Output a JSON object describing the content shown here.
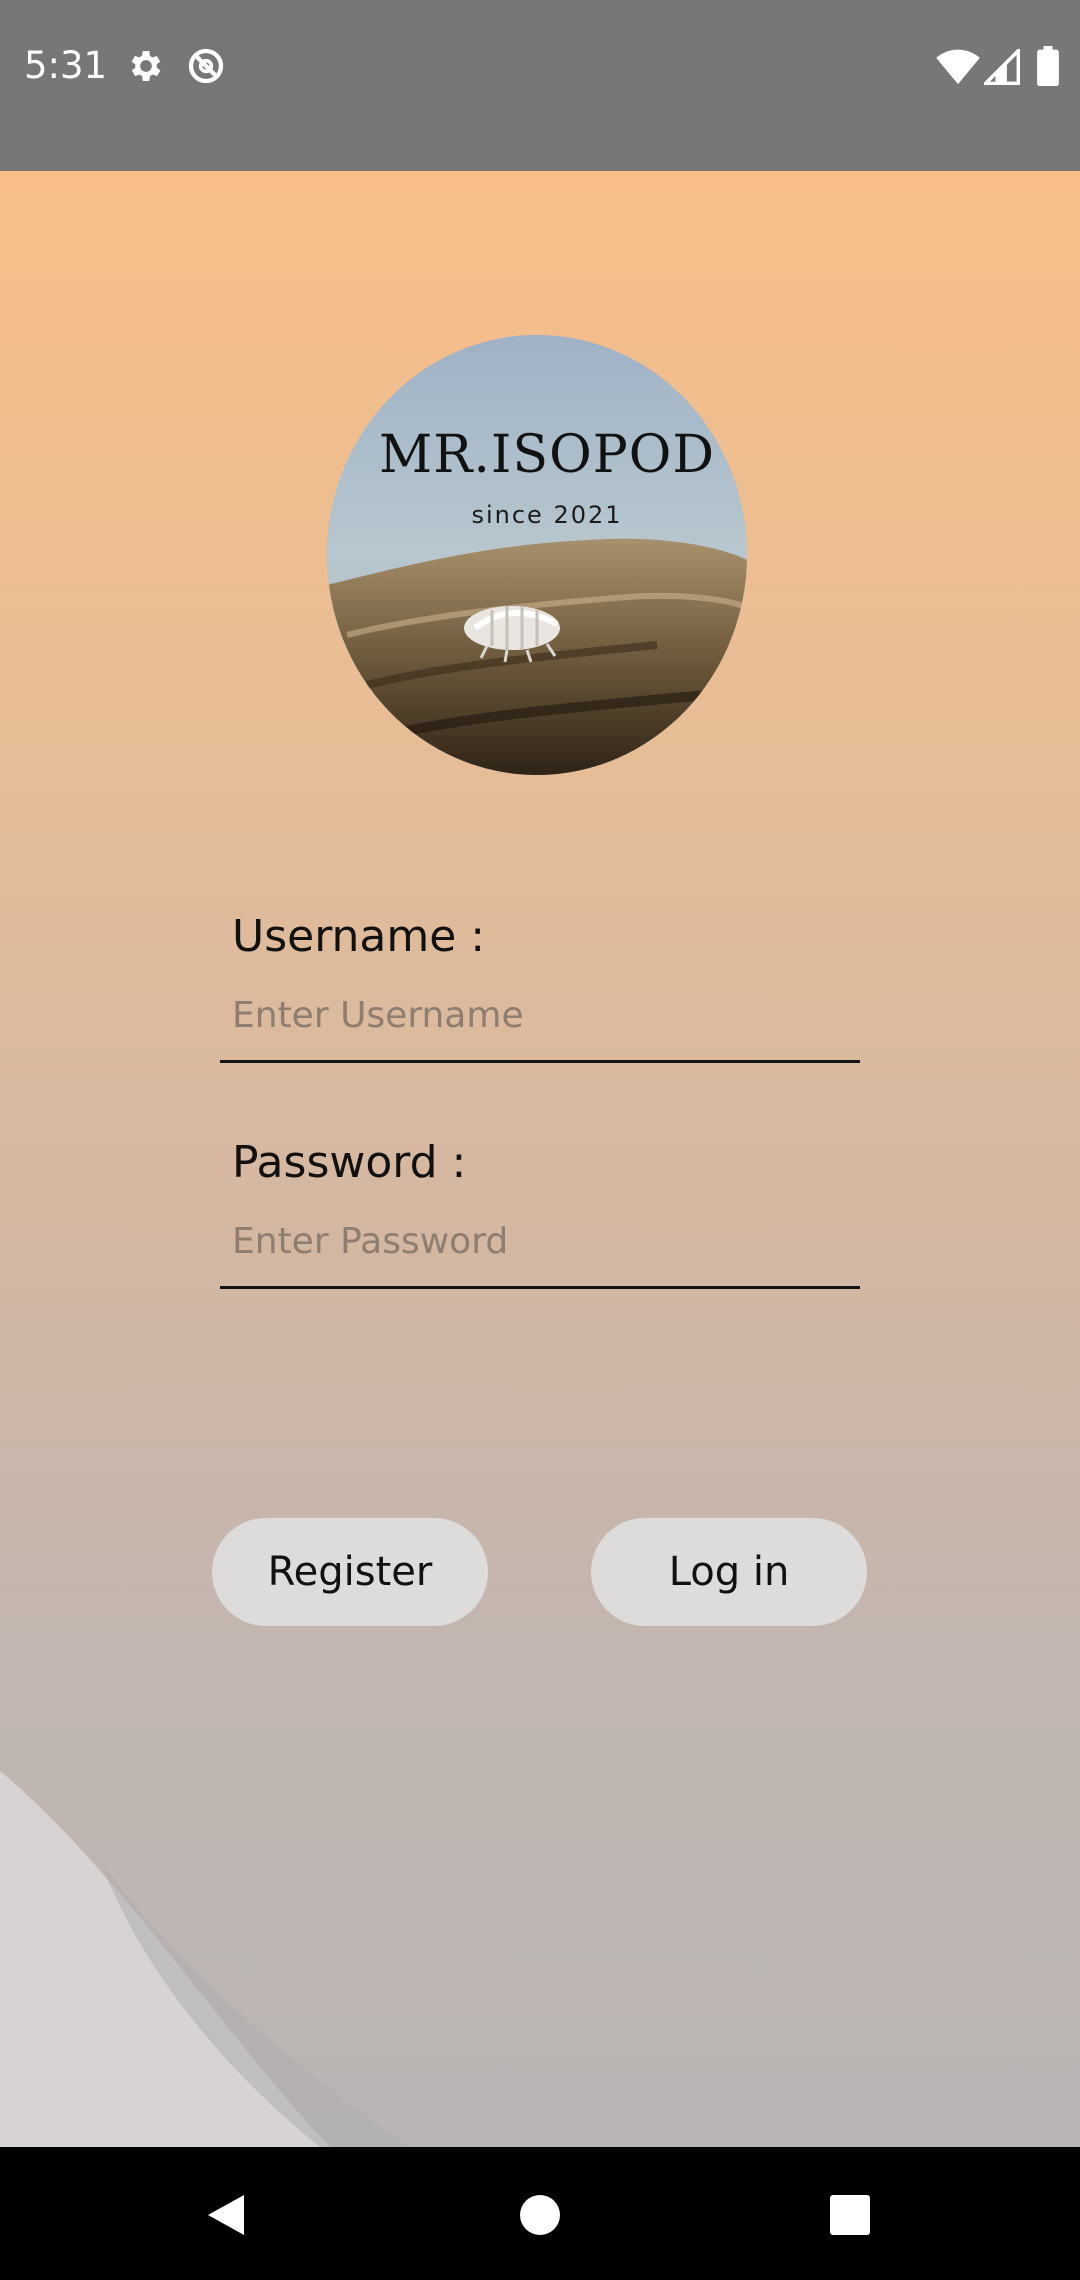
{
  "status_bar": {
    "time": "5:31",
    "icons": [
      "gear-icon",
      "do-not-disturb-icon",
      "wifi-icon",
      "signal-icon",
      "battery-icon"
    ]
  },
  "logo": {
    "title": "MR.ISOPOD",
    "subtitle": "since 2021"
  },
  "form": {
    "username_label": "Username :",
    "username_placeholder": "Enter Username",
    "username_value": "",
    "password_label": "Password :",
    "password_placeholder": "Enter Password",
    "password_value": ""
  },
  "buttons": {
    "register_label": "Register",
    "login_label": "Log in"
  },
  "nav_bar": {
    "icons": [
      "back-icon",
      "home-icon",
      "recents-icon"
    ]
  },
  "colors": {
    "status_bar": "#777777",
    "gradient_top": "#f8bf88",
    "gradient_bottom": "#b9b5b4",
    "button_bg": "#dddcdb",
    "nav_bar": "#000000"
  }
}
